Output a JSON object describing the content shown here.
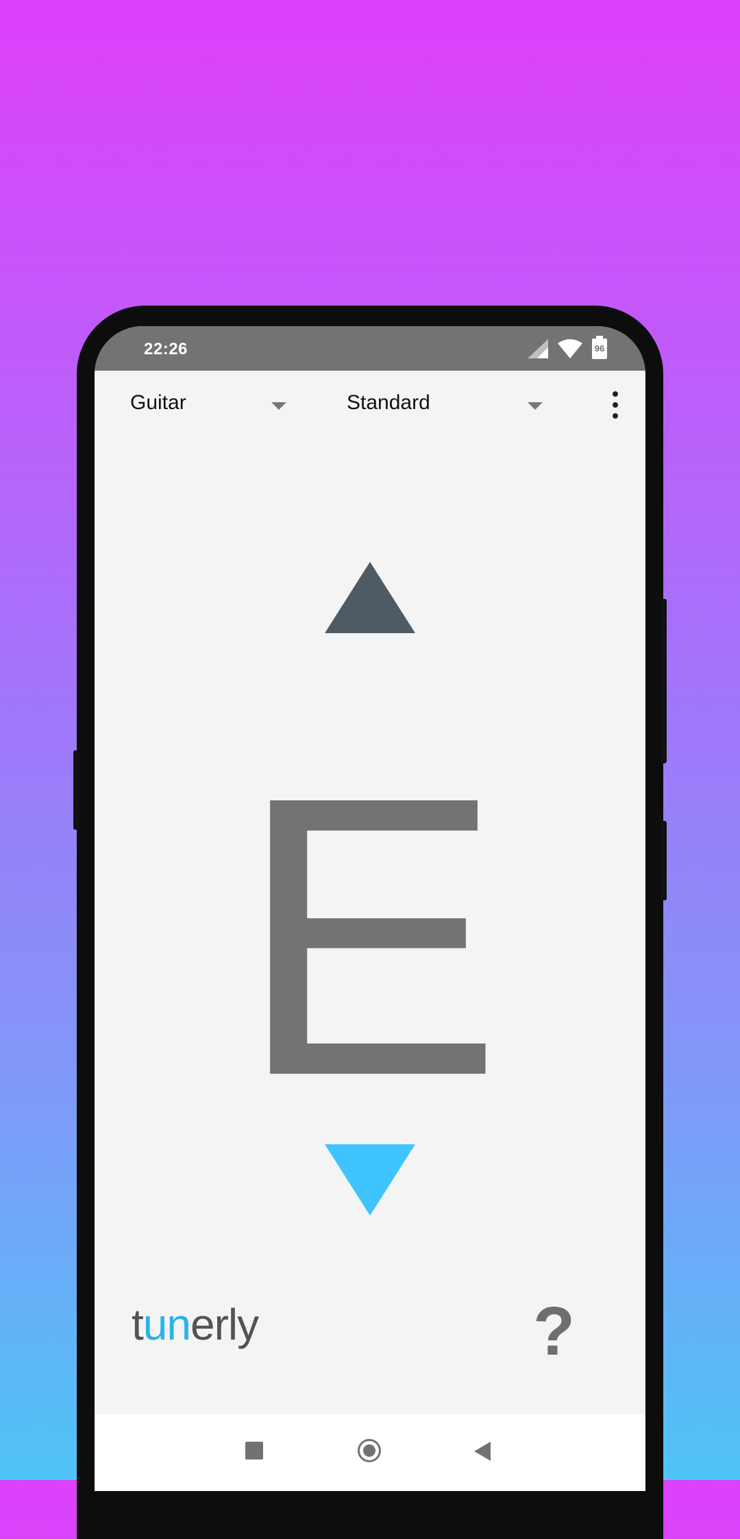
{
  "status_bar": {
    "time": "22:26",
    "battery_level": "96",
    "icons": [
      "signal-icon",
      "wifi-icon",
      "battery-icon"
    ]
  },
  "toolbar": {
    "instrument": "Guitar",
    "tuning": "Standard",
    "menu_icon": "more-vert-icon"
  },
  "tuner": {
    "note": "E",
    "up_indicator_color": "#4e5b64",
    "down_indicator_color": "#40c4ff",
    "note_color": "#737373"
  },
  "footer": {
    "logo_text_1": "t",
    "logo_text_accent": "un",
    "logo_text_2": "erly",
    "help_label": "?"
  },
  "nav_bar": {
    "icons": [
      "recents-icon",
      "home-icon",
      "back-icon"
    ]
  },
  "colors": {
    "gradient_top": "#de40fb",
    "gradient_bottom": "#4fc4f7",
    "accent": "#29b3e8"
  }
}
